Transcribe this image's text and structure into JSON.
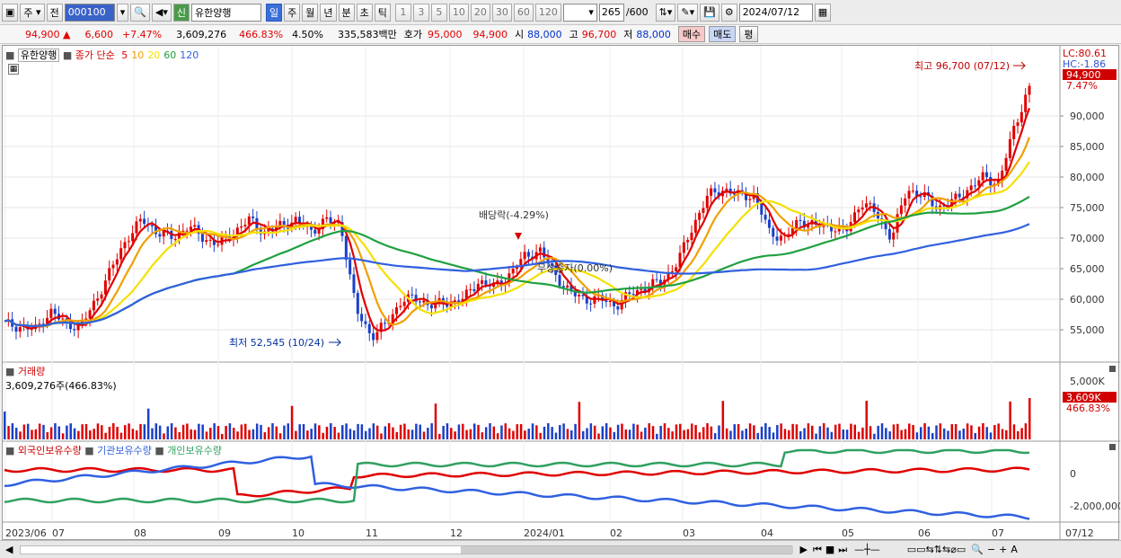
{
  "toolbar": {
    "period_type": "주",
    "prev_label": "전",
    "code": "000100",
    "market_badge": "신",
    "stock_name": "유한양행",
    "periods": [
      "일",
      "주",
      "월",
      "년",
      "분",
      "초",
      "틱"
    ],
    "selected_period": "일",
    "intervals": [
      "1",
      "3",
      "5",
      "10",
      "20",
      "30",
      "60",
      "120"
    ],
    "count": "265",
    "count_total": "/600",
    "date": "2024/07/12"
  },
  "quote": {
    "price": "94,900 ▲",
    "change": "6,600",
    "change_pct": "+7.47%",
    "volume": "3,609,276",
    "volume_pct": "466.83%",
    "turnover": "4.50%",
    "amount": "335,583백만",
    "ask_label": "호가",
    "ask": "95,000",
    "bid": "94,900",
    "open_label": "시",
    "open": "88,000",
    "high_label": "고",
    "high": "96,700",
    "low_label": "저",
    "low": "88,000",
    "buy_label": "매수",
    "sell_label": "매도",
    "eval_label": "평"
  },
  "price_panel": {
    "stock_label": "유한양행",
    "indicator_label": "종가 단순",
    "ma_periods": [
      "5",
      "10",
      "20",
      "60",
      "120"
    ],
    "ma_colors": [
      "#e00000",
      "#f0a000",
      "#f5e000",
      "#20a040",
      "#3060e0"
    ],
    "lc": "LC:80.61",
    "hc": "HC:-1.86",
    "current_price_tag": "94,900",
    "current_pct_tag": "7.47%",
    "high_note": "최고 96,700 (07/12)",
    "low_note": "최저 52,545 (10/24)",
    "dividend_note": "배당락(-4.29%)",
    "capital_note": "무상증자(0.00%)"
  },
  "volume_panel": {
    "title": "거래량",
    "value": "3,609,276주(466.83%)",
    "tag": "3,609K",
    "pct_tag": "466.83%"
  },
  "holdings_panel": {
    "legend": [
      "외국인보유수량",
      "기관보유수량",
      "개인보유수량"
    ],
    "colors": [
      "#e00000",
      "#3060e0",
      "#30a060"
    ]
  },
  "x_axis": [
    "2023/06",
    "07",
    "08",
    "09",
    "10",
    "11",
    "12",
    "2024/01",
    "02",
    "03",
    "04",
    "05",
    "06",
    "07"
  ],
  "x_axis_end": "07/12",
  "chart_data": {
    "type": "line",
    "title": "",
    "price_ylim": [
      50000,
      100000
    ],
    "price_ticks": [
      "90,000",
      "85,000",
      "80,000",
      "75,000",
      "70,000",
      "65,000",
      "60,000",
      "55,000"
    ],
    "volume_ticks": [
      "5,000K"
    ],
    "holdings_ticks": [
      "0",
      "-2,000,000"
    ],
    "close_approx": [
      56000,
      55500,
      55000,
      58000,
      56000,
      55500,
      60000,
      65000,
      70000,
      73000,
      71000,
      70000,
      72000,
      70000,
      69000,
      71000,
      73000,
      71000,
      72000,
      73000,
      71000,
      73000,
      72000,
      58000,
      54000,
      56000,
      60000,
      60000,
      59000,
      59500,
      60000,
      63000,
      62000,
      64000,
      67000,
      68000,
      64000,
      61000,
      60000,
      60000,
      59000,
      61000,
      62000,
      63000,
      66000,
      72000,
      77000,
      78000,
      77000,
      77000,
      71000,
      70000,
      73000,
      72000,
      72000,
      71000,
      76000,
      74000,
      70000,
      78000,
      77000,
      75000,
      76000,
      78000,
      80000,
      79000,
      88000,
      94900
    ]
  }
}
